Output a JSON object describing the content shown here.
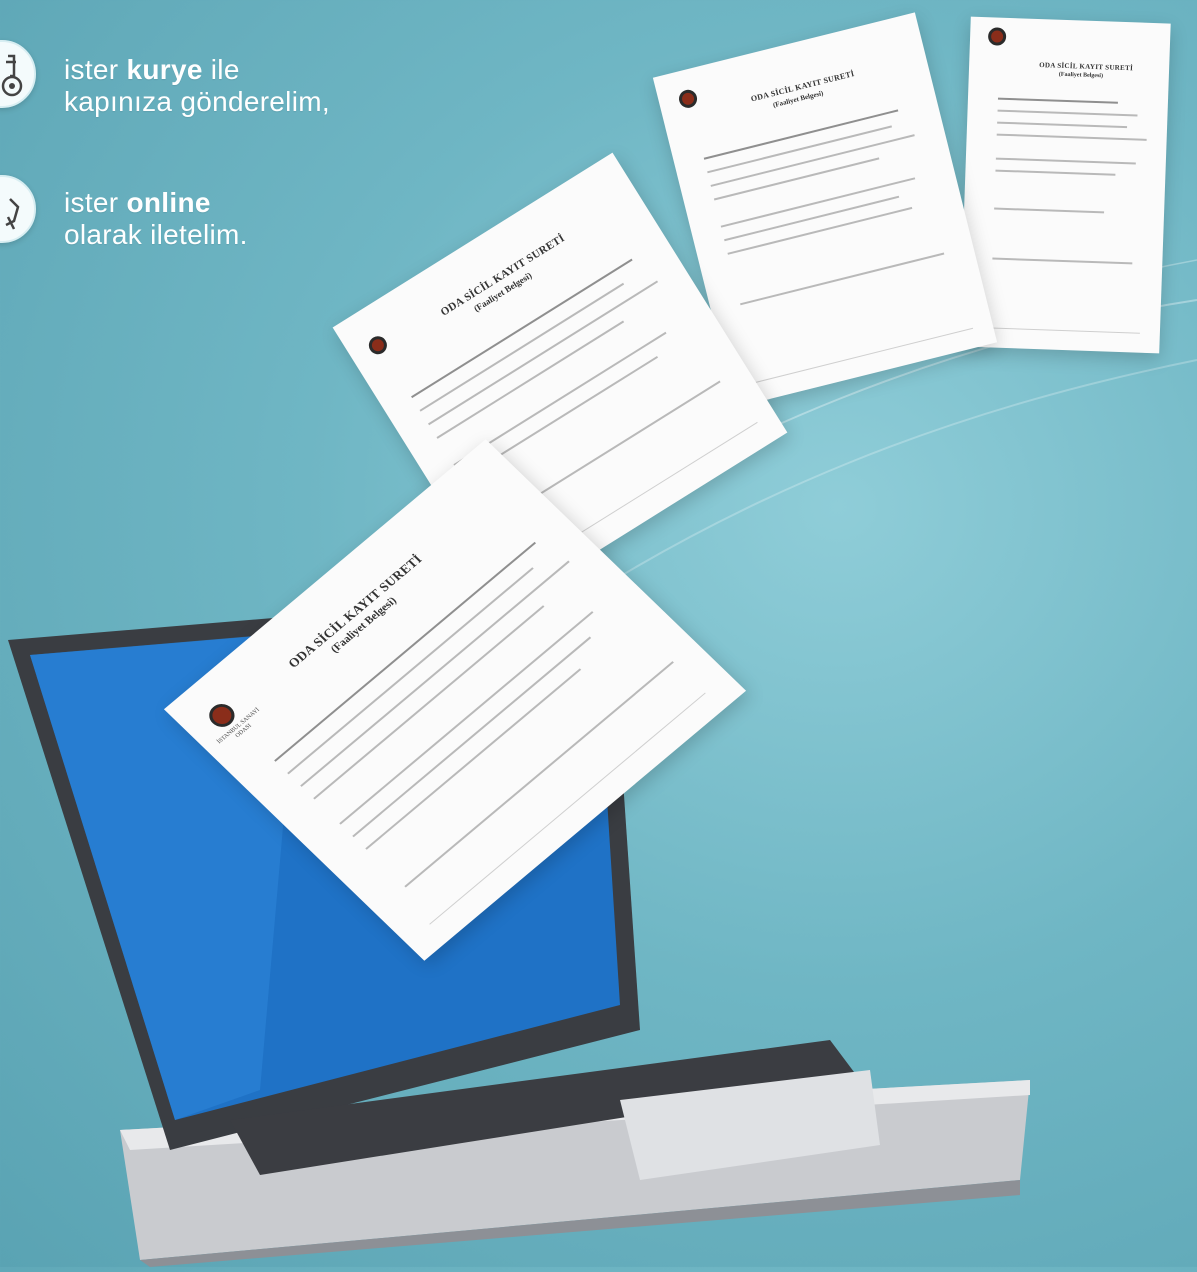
{
  "delivery_options": [
    {
      "prefix": "ister ",
      "emphasis": "kurye",
      "suffix": " ile",
      "line2": "kapınıza gönderelim,",
      "icon": "courier-icon"
    },
    {
      "prefix": "ister ",
      "emphasis": "online",
      "suffix": "",
      "line2": "olarak iletelim.",
      "icon": "online-icon"
    }
  ],
  "document": {
    "title": "ODA SİCİL KAYIT SURETİ",
    "subtitle": "(Faaliyet Belgesi)",
    "issuer": "İSTANBUL SANAYİ ODASI"
  },
  "colors": {
    "background": "#6fb6c4",
    "text": "#ffffff",
    "logo": "#8a2d1a"
  }
}
